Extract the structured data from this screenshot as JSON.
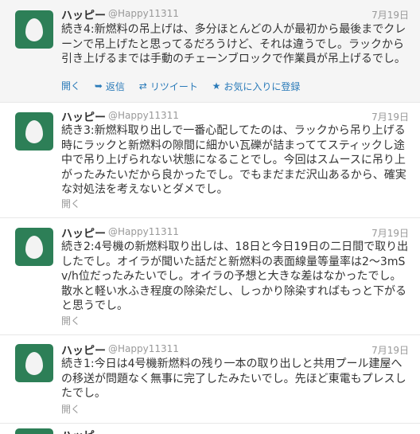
{
  "tweets": [
    {
      "name": "ハッピー",
      "handle": "@Happy11311",
      "time": "7月19日",
      "text": "続き4:新燃料の吊上げは、多分ほとんどの人が最初から最後までクレーンで吊上げたと思ってるだろうけど、それは違うでし。ラックから引き上げるまでは手動のチェーンブロックで作業員が吊上げるでし。",
      "actions": {
        "open": "開く",
        "reply": "返信",
        "retweet": "リツイート",
        "favorite": "お気に入りに登録"
      }
    },
    {
      "name": "ハッピー",
      "handle": "@Happy11311",
      "time": "7月19日",
      "text": "続き3:新燃料取り出しで一番心配してたのは、ラックから吊り上げる時にラックと新燃料の隙間に細かい瓦礫が詰まっててスティックし途中で吊り上げられない状態になることでし。今回はスムースに吊り上がったみたいだから良かったでし。でもまだまだ沢山あるから、確実な対処法を考えないとダメでし。",
      "open": "開く"
    },
    {
      "name": "ハッピー",
      "handle": "@Happy11311",
      "time": "7月19日",
      "text": "続き2:4号機の新燃料取り出しは、18日と今日19日の二日間で取り出したでし。オイラが聞いた話だと新燃料の表面線量等量率は2〜3mSv/h位だったみたいでし。オイラの予想と大きな差はなかったでし。散水と軽い水ふき程度の除染だし、しっかり除染すればもっと下がると思うでし。",
      "open": "開く"
    },
    {
      "name": "ハッピー",
      "handle": "@Happy11311",
      "time": "7月19日",
      "text": "続き1:今日は4号機新燃料の残り一本の取り出しと共用プール建屋への移送が問題なく無事に完了したみたいでし。先ほど東電もプレスしたでし。",
      "open": "開く"
    }
  ],
  "partial": {
    "name": "ハッピー"
  }
}
